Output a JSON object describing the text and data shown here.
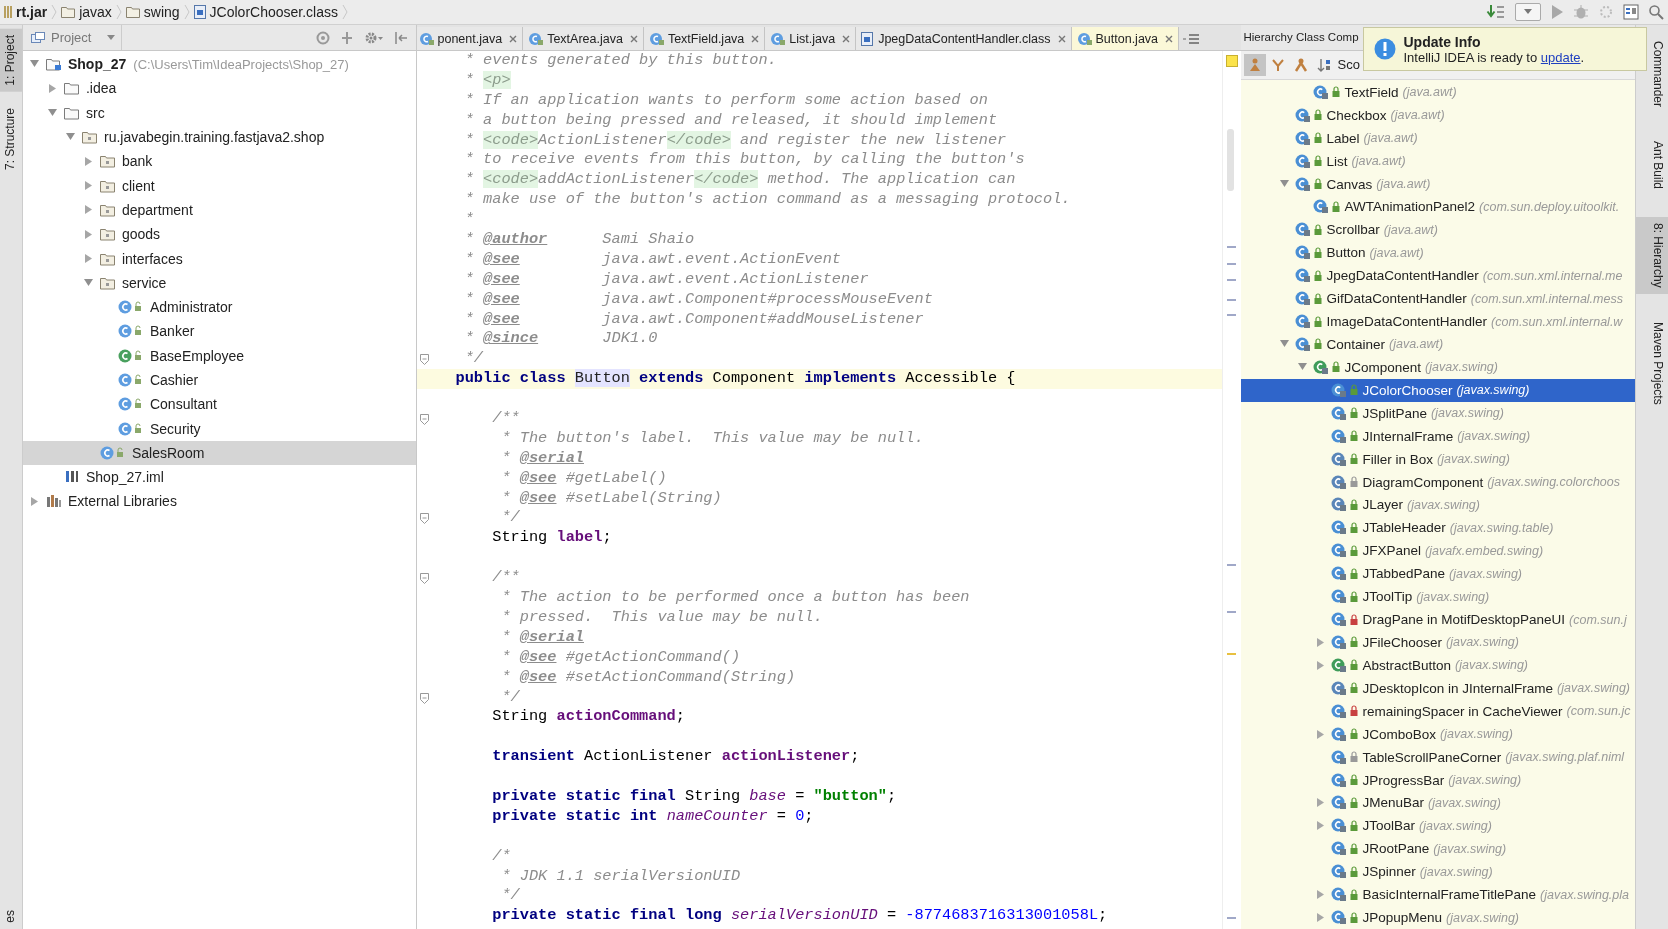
{
  "breadcrumbs": [
    {
      "label": "rt.jar",
      "kind": "jar"
    },
    {
      "label": "javax",
      "kind": "folder"
    },
    {
      "label": "swing",
      "kind": "folder"
    },
    {
      "label": "JColorChooser.class",
      "kind": "classfile"
    }
  ],
  "left_stripe": [
    {
      "label": "1: Project",
      "selected": true
    },
    {
      "label": "7: Structure",
      "selected": false
    },
    {
      "label": "es",
      "selected": false
    }
  ],
  "project": {
    "title": "Project",
    "tree": [
      {
        "label": "Shop_27",
        "hint": "(C:\\Users\\Tim\\IdeaProjects\\Shop_27)",
        "kind": "module",
        "expanded": true,
        "selected": false,
        "children": [
          {
            "label": ".idea",
            "kind": "folder",
            "expanded": false,
            "selected": false
          },
          {
            "label": "src",
            "kind": "folder",
            "expanded": true,
            "selected": false,
            "children": [
              {
                "label": "ru.javabegin.training.fastjava2.shop",
                "kind": "package",
                "expanded": true,
                "selected": false,
                "children": [
                  {
                    "label": "bank",
                    "kind": "package",
                    "expanded": false,
                    "selected": false
                  },
                  {
                    "label": "client",
                    "kind": "package",
                    "expanded": false,
                    "selected": false
                  },
                  {
                    "label": "department",
                    "kind": "package",
                    "expanded": false,
                    "selected": false
                  },
                  {
                    "label": "goods",
                    "kind": "package",
                    "expanded": false,
                    "selected": false
                  },
                  {
                    "label": "interfaces",
                    "kind": "package",
                    "expanded": false,
                    "selected": false
                  },
                  {
                    "label": "service",
                    "kind": "package",
                    "expanded": true,
                    "selected": false,
                    "children": [
                      {
                        "label": "Administrator",
                        "kind": "class",
                        "selected": false
                      },
                      {
                        "label": "Banker",
                        "kind": "class",
                        "selected": false
                      },
                      {
                        "label": "BaseEmployee",
                        "kind": "abstract",
                        "selected": false
                      },
                      {
                        "label": "Cashier",
                        "kind": "class",
                        "selected": false
                      },
                      {
                        "label": "Consultant",
                        "kind": "class",
                        "selected": false
                      },
                      {
                        "label": "Security",
                        "kind": "class",
                        "selected": false
                      }
                    ]
                  },
                  {
                    "label": "SalesRoom",
                    "kind": "class",
                    "selected": true
                  }
                ]
              }
            ]
          },
          {
            "label": "Shop_27.iml",
            "kind": "iml",
            "selected": false
          }
        ]
      },
      {
        "label": "External Libraries",
        "kind": "libraries",
        "expanded": false,
        "selected": false
      }
    ]
  },
  "editor": {
    "tabs": [
      {
        "label": "ponent.java",
        "kind": "java",
        "selected": false
      },
      {
        "label": "TextArea.java",
        "kind": "java",
        "selected": false
      },
      {
        "label": "TextField.java",
        "kind": "java",
        "selected": false
      },
      {
        "label": "List.java",
        "kind": "java",
        "selected": false
      },
      {
        "label": "JpegDataContentHandler.class",
        "kind": "classfile",
        "selected": false
      },
      {
        "label": "Button.java",
        "kind": "java",
        "selected": true
      }
    ],
    "lines": [
      {
        "kind": "doc",
        "current": false,
        "segs": [
          {
            "kind": "comment",
            "text": "* events generated by this button."
          }
        ]
      },
      {
        "kind": "doc",
        "current": false,
        "segs": [
          {
            "kind": "comment",
            "text": "* "
          },
          {
            "kind": "tag",
            "text": "<p>"
          }
        ]
      },
      {
        "kind": "doc",
        "current": false,
        "segs": [
          {
            "kind": "comment",
            "text": "* If an application wants to perform some action based on"
          }
        ]
      },
      {
        "kind": "doc",
        "current": false,
        "segs": [
          {
            "kind": "comment",
            "text": "* a button being pressed and released, it should implement"
          }
        ]
      },
      {
        "kind": "doc",
        "current": false,
        "segs": [
          {
            "kind": "comment",
            "text": "* "
          },
          {
            "kind": "tag",
            "text": "<code>"
          },
          {
            "kind": "comment",
            "text": "ActionListener"
          },
          {
            "kind": "tag",
            "text": "</code>"
          },
          {
            "kind": "comment",
            "text": " and register the new listener"
          }
        ]
      },
      {
        "kind": "doc",
        "current": false,
        "segs": [
          {
            "kind": "comment",
            "text": "* to receive events from this button, by calling the button's"
          }
        ]
      },
      {
        "kind": "doc",
        "current": false,
        "segs": [
          {
            "kind": "comment",
            "text": "* "
          },
          {
            "kind": "tag",
            "text": "<code>"
          },
          {
            "kind": "comment",
            "text": "addActionListener"
          },
          {
            "kind": "tag",
            "text": "</code>"
          },
          {
            "kind": "comment",
            "text": " method. The application can"
          }
        ]
      },
      {
        "kind": "doc",
        "current": false,
        "segs": [
          {
            "kind": "comment",
            "text": "* make use of the button's action command as a messaging protocol."
          }
        ]
      },
      {
        "kind": "doc",
        "current": false,
        "segs": [
          {
            "kind": "comment",
            "text": "*"
          }
        ]
      },
      {
        "kind": "doc",
        "current": false,
        "segs": [
          {
            "kind": "comment",
            "text": "* "
          },
          {
            "kind": "doctag",
            "text": "@author"
          },
          {
            "kind": "comment",
            "text": "      Sami Shaio"
          }
        ]
      },
      {
        "kind": "doc",
        "current": false,
        "segs": [
          {
            "kind": "comment",
            "text": "* "
          },
          {
            "kind": "doctag",
            "text": "@see"
          },
          {
            "kind": "comment",
            "text": "         java.awt.event.ActionEvent"
          }
        ]
      },
      {
        "kind": "doc",
        "current": false,
        "segs": [
          {
            "kind": "comment",
            "text": "* "
          },
          {
            "kind": "doctag",
            "text": "@see"
          },
          {
            "kind": "comment",
            "text": "         java.awt.event.ActionListener"
          }
        ]
      },
      {
        "kind": "doc",
        "current": false,
        "segs": [
          {
            "kind": "comment",
            "text": "* "
          },
          {
            "kind": "doctag",
            "text": "@see"
          },
          {
            "kind": "comment",
            "text": "         java.awt.Component#processMouseEvent"
          }
        ]
      },
      {
        "kind": "doc",
        "current": false,
        "segs": [
          {
            "kind": "comment",
            "text": "* "
          },
          {
            "kind": "doctag",
            "text": "@see"
          },
          {
            "kind": "comment",
            "text": "         java.awt.Component#addMouseListener"
          }
        ]
      },
      {
        "kind": "doc",
        "current": false,
        "segs": [
          {
            "kind": "comment",
            "text": "* "
          },
          {
            "kind": "doctag",
            "text": "@since"
          },
          {
            "kind": "comment",
            "text": "       JDK1.0"
          }
        ]
      },
      {
        "kind": "doc",
        "current": false,
        "fold": true,
        "segs": [
          {
            "kind": "comment",
            "text": "*/"
          }
        ]
      },
      {
        "kind": "code",
        "current": true,
        "segs": [
          {
            "kind": "keyword",
            "text": "public class "
          },
          {
            "kind": "highlight",
            "text": "Button"
          },
          {
            "kind": "keyword",
            "text": " extends "
          },
          {
            "kind": "plain",
            "text": "Component"
          },
          {
            "kind": "keyword",
            "text": " implements "
          },
          {
            "kind": "plain",
            "text": "Accessible {"
          }
        ]
      },
      {
        "kind": "code",
        "current": false
      },
      {
        "kind": "mcode",
        "current": false,
        "fold": true,
        "segs": [
          {
            "kind": "comment",
            "text": "/**"
          }
        ]
      },
      {
        "kind": "mdoc",
        "current": false,
        "segs": [
          {
            "kind": "comment",
            "text": "* The button's label.  This value may be null."
          }
        ]
      },
      {
        "kind": "mdoc",
        "current": false,
        "segs": [
          {
            "kind": "comment",
            "text": "* "
          },
          {
            "kind": "doctag",
            "text": "@serial"
          }
        ]
      },
      {
        "kind": "mdoc",
        "current": false,
        "segs": [
          {
            "kind": "comment",
            "text": "* "
          },
          {
            "kind": "doctag",
            "text": "@see"
          },
          {
            "kind": "comment",
            "text": " #getLabel()"
          }
        ]
      },
      {
        "kind": "mdoc",
        "current": false,
        "segs": [
          {
            "kind": "comment",
            "text": "* "
          },
          {
            "kind": "doctag",
            "text": "@see"
          },
          {
            "kind": "comment",
            "text": " #setLabel(String)"
          }
        ]
      },
      {
        "kind": "mdoc",
        "current": false,
        "fold": true,
        "segs": [
          {
            "kind": "comment",
            "text": "*/"
          }
        ]
      },
      {
        "kind": "mcode",
        "current": false,
        "segs": [
          {
            "kind": "plain",
            "text": "String "
          },
          {
            "kind": "field",
            "text": "label"
          },
          {
            "kind": "plain",
            "text": ";"
          }
        ]
      },
      {
        "kind": "code",
        "current": false
      },
      {
        "kind": "mcode",
        "current": false,
        "fold": true,
        "segs": [
          {
            "kind": "comment",
            "text": "/**"
          }
        ]
      },
      {
        "kind": "mdoc",
        "current": false,
        "segs": [
          {
            "kind": "comment",
            "text": "* The action to be performed once a button has been"
          }
        ]
      },
      {
        "kind": "mdoc",
        "current": false,
        "segs": [
          {
            "kind": "comment",
            "text": "* pressed.  This value may be null."
          }
        ]
      },
      {
        "kind": "mdoc",
        "current": false,
        "segs": [
          {
            "kind": "comment",
            "text": "* "
          },
          {
            "kind": "doctag",
            "text": "@serial"
          }
        ]
      },
      {
        "kind": "mdoc",
        "current": false,
        "segs": [
          {
            "kind": "comment",
            "text": "* "
          },
          {
            "kind": "doctag",
            "text": "@see"
          },
          {
            "kind": "comment",
            "text": " #getActionCommand()"
          }
        ]
      },
      {
        "kind": "mdoc",
        "current": false,
        "segs": [
          {
            "kind": "comment",
            "text": "* "
          },
          {
            "kind": "doctag",
            "text": "@see"
          },
          {
            "kind": "comment",
            "text": " #setActionCommand(String)"
          }
        ]
      },
      {
        "kind": "mdoc",
        "current": false,
        "fold": true,
        "segs": [
          {
            "kind": "comment",
            "text": "*/"
          }
        ]
      },
      {
        "kind": "mcode",
        "current": false,
        "segs": [
          {
            "kind": "plain",
            "text": "String "
          },
          {
            "kind": "field",
            "text": "actionCommand"
          },
          {
            "kind": "plain",
            "text": ";"
          }
        ]
      },
      {
        "kind": "code",
        "current": false
      },
      {
        "kind": "mcode",
        "current": false,
        "segs": [
          {
            "kind": "keyword",
            "text": "transient "
          },
          {
            "kind": "plain",
            "text": "ActionListener "
          },
          {
            "kind": "field",
            "text": "actionListener"
          },
          {
            "kind": "plain",
            "text": ";"
          }
        ]
      },
      {
        "kind": "code",
        "current": false
      },
      {
        "kind": "mcode",
        "current": false,
        "segs": [
          {
            "kind": "keyword",
            "text": "private static final "
          },
          {
            "kind": "plain",
            "text": "String "
          },
          {
            "kind": "static",
            "text": "base"
          },
          {
            "kind": "plain",
            "text": " = "
          },
          {
            "kind": "string",
            "text": "\"button\""
          },
          {
            "kind": "plain",
            "text": ";"
          }
        ]
      },
      {
        "kind": "mcode",
        "current": false,
        "segs": [
          {
            "kind": "keyword",
            "text": "private static int "
          },
          {
            "kind": "static",
            "text": "nameCounter"
          },
          {
            "kind": "plain",
            "text": " = "
          },
          {
            "kind": "number",
            "text": "0"
          },
          {
            "kind": "plain",
            "text": ";"
          }
        ]
      },
      {
        "kind": "code",
        "current": false
      },
      {
        "kind": "mcode",
        "current": false,
        "segs": [
          {
            "kind": "comment",
            "text": "/*"
          }
        ]
      },
      {
        "kind": "mdoc",
        "current": false,
        "segs": [
          {
            "kind": "comment",
            "text": "* JDK 1.1 serialVersionUID"
          }
        ]
      },
      {
        "kind": "mdoc",
        "current": false,
        "segs": [
          {
            "kind": "comment",
            "text": "*/"
          }
        ]
      },
      {
        "kind": "mcode",
        "current": false,
        "segs": [
          {
            "kind": "keyword",
            "text": "private static final long "
          },
          {
            "kind": "static",
            "text": "serialVersionUID"
          },
          {
            "kind": "plain",
            "text": " = "
          },
          {
            "kind": "number",
            "text": "-8774683716313001058L"
          },
          {
            "kind": "plain",
            "text": ";"
          }
        ]
      }
    ]
  },
  "hierarchy": {
    "title": "Hierarchy Class Comp",
    "scope": "Sco",
    "popup": {
      "title": "Update Info",
      "before": "IntelliJ IDEA is ready to ",
      "link": "update",
      "after": "."
    },
    "tree": [
      {
        "children": [
          {
            "label": "TextField",
            "pkg": "(java.awt)",
            "kind": "class",
            "color": "#5a9a3a",
            "selected": false
          }
        ]
      },
      {
        "label": "Checkbox",
        "pkg": "(java.awt)",
        "kind": "class",
        "color": "#5a9a3a",
        "selected": false
      },
      {
        "label": "Label",
        "pkg": "(java.awt)",
        "kind": "class",
        "color": "#5a9a3a",
        "selected": false
      },
      {
        "label": "List",
        "pkg": "(java.awt)",
        "kind": "class",
        "color": "#5a9a3a",
        "selected": false
      },
      {
        "label": "Canvas",
        "pkg": "(java.awt)",
        "kind": "class",
        "color": "#5a9a3a",
        "expanded": true,
        "selected": false,
        "children": [
          {
            "label": "AWTAnimationPanel2",
            "pkg": "(com.sun.deploy.uitoolkit.",
            "kind": "class",
            "color": "#5a9a3a",
            "selected": false
          }
        ]
      },
      {
        "label": "Scrollbar",
        "pkg": "(java.awt)",
        "kind": "class",
        "color": "#5a9a3a",
        "selected": false
      },
      {
        "label": "Button",
        "pkg": "(java.awt)",
        "kind": "class",
        "color": "#5a9a3a",
        "selected": false
      },
      {
        "label": "JpegDataContentHandler",
        "pkg": "(com.sun.xml.internal.me",
        "kind": "class",
        "color": "#5a9a3a",
        "selected": false
      },
      {
        "label": "GifDataContentHandler",
        "pkg": "(com.sun.xml.internal.mess",
        "kind": "class",
        "color": "#5a9a3a",
        "selected": false
      },
      {
        "label": "ImageDataContentHandler",
        "pkg": "(com.sun.xml.internal.w",
        "kind": "class",
        "color": "#5a9a3a",
        "selected": false
      },
      {
        "label": "Container",
        "pkg": "(java.awt)",
        "kind": "class",
        "color": "#5a9a3a",
        "expanded": true,
        "selected": false,
        "children": [
          {
            "label": "JComponent",
            "pkg": "(javax.swing)",
            "kind": "abstract",
            "color": "#5a9a3a",
            "expanded": true,
            "selected": false,
            "children": [
              {
                "label": "JColorChooser",
                "pkg": "(javax.swing)",
                "kind": "class",
                "color": "#5a9a3a",
                "selected": true
              },
              {
                "label": "JSplitPane",
                "pkg": "(javax.swing)",
                "kind": "class",
                "color": "#5a9a3a",
                "selected": false
              },
              {
                "label": "JInternalFrame",
                "pkg": "(javax.swing)",
                "kind": "class",
                "color": "#5a9a3a",
                "selected": false
              },
              {
                "label": "Filler in Box",
                "pkg": "(javax.swing)",
                "kind": "inner",
                "color": "#5a9a3a",
                "selected": false
              },
              {
                "label": "DiagramComponent",
                "pkg": "(javax.swing.colorchoos",
                "kind": "inner",
                "color": "#999999",
                "selected": false
              },
              {
                "label": "JLayer",
                "pkg": "(javax.swing)",
                "kind": "inner",
                "color": "#5a9a3a",
                "selected": false
              },
              {
                "label": "JTableHeader",
                "pkg": "(javax.swing.table)",
                "kind": "class",
                "color": "#5a9a3a",
                "selected": false
              },
              {
                "label": "JFXPanel",
                "pkg": "(javafx.embed.swing)",
                "kind": "class",
                "color": "#5a9a3a",
                "selected": false
              },
              {
                "label": "JTabbedPane",
                "pkg": "(javax.swing)",
                "kind": "class",
                "color": "#5a9a3a",
                "selected": false
              },
              {
                "label": "JToolTip",
                "pkg": "(javax.swing)",
                "kind": "class",
                "color": "#5a9a3a",
                "selected": false
              },
              {
                "label": "DragPane in MotifDesktopPaneUI",
                "pkg": "(com.sun.j",
                "kind": "class",
                "color": "#c84040",
                "selected": false
              },
              {
                "label": "JFileChooser",
                "pkg": "(javax.swing)",
                "kind": "class",
                "color": "#5a9a3a",
                "expanded": false,
                "selected": false
              },
              {
                "label": "AbstractButton",
                "pkg": "(javax.swing)",
                "kind": "abstract",
                "color": "#5a9a3a",
                "expanded": false,
                "selected": false
              },
              {
                "label": "JDesktopIcon in JInternalFrame",
                "pkg": "(javax.swing)",
                "kind": "inner",
                "color": "#5a9a3a",
                "selected": false
              },
              {
                "label": "remainingSpacer in CacheViewer",
                "pkg": "(com.sun.jc",
                "kind": "class",
                "color": "#c84040",
                "selected": false
              },
              {
                "label": "JComboBox",
                "pkg": "(javax.swing)",
                "kind": "class",
                "color": "#5a9a3a",
                "expanded": false,
                "selected": false
              },
              {
                "label": "TableScrollPaneCorner",
                "pkg": "(javax.swing.plaf.niml",
                "kind": "class",
                "color": "#999999",
                "selected": false
              },
              {
                "label": "JProgressBar",
                "pkg": "(javax.swing)",
                "kind": "class",
                "color": "#5a9a3a",
                "selected": false
              },
              {
                "label": "JMenuBar",
                "pkg": "(javax.swing)",
                "kind": "class",
                "color": "#5a9a3a",
                "expanded": false,
                "selected": false
              },
              {
                "label": "JToolBar",
                "pkg": "(javax.swing)",
                "kind": "class",
                "color": "#5a9a3a",
                "expanded": false,
                "selected": false
              },
              {
                "label": "JRootPane",
                "pkg": "(javax.swing)",
                "kind": "class",
                "color": "#5a9a3a",
                "selected": false
              },
              {
                "label": "JSpinner",
                "pkg": "(javax.swing)",
                "kind": "class",
                "color": "#5a9a3a",
                "selected": false
              },
              {
                "label": "BasicInternalFrameTitlePane",
                "pkg": "(javax.swing.pla",
                "kind": "class",
                "color": "#5a9a3a",
                "expanded": false,
                "selected": false
              },
              {
                "label": "JPopupMenu",
                "pkg": "(javax.swing)",
                "kind": "class",
                "color": "#5a9a3a",
                "expanded": false,
                "selected": false
              }
            ]
          }
        ]
      }
    ]
  },
  "right_stripe": [
    {
      "label": "Commander",
      "selected": false
    },
    {
      "label": "Ant Build",
      "selected": false
    },
    {
      "label": "8: Hierarchy",
      "selected": true
    },
    {
      "label": "Maven Projects",
      "selected": false
    }
  ]
}
